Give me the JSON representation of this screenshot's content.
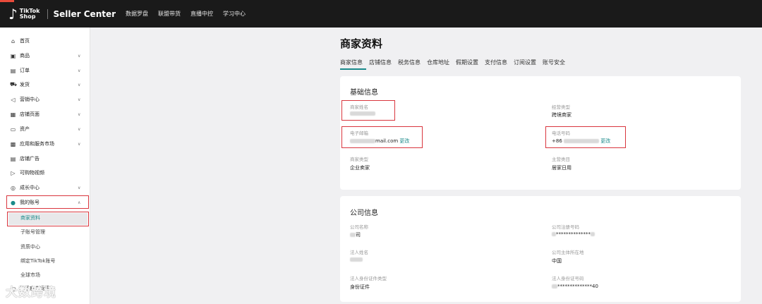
{
  "topbar": {
    "logo_line1": "TikTok",
    "logo_line2": "Shop",
    "seller_center": "Seller Center",
    "nav": [
      "数据罗盘",
      "联盟带货",
      "直播中控",
      "学习中心"
    ]
  },
  "sidebar": {
    "items": [
      {
        "label": "首页",
        "icon": "home-icon",
        "glyph": "⌂",
        "chevron": false
      },
      {
        "label": "商品",
        "icon": "product-icon",
        "glyph": "▣",
        "chevron": true
      },
      {
        "label": "订单",
        "icon": "order-icon",
        "glyph": "▤",
        "chevron": true
      },
      {
        "label": "发货",
        "icon": "truck-icon",
        "glyph": "⛟",
        "chevron": true
      },
      {
        "label": "营销中心",
        "icon": "megaphone-icon",
        "glyph": "◁",
        "chevron": true
      },
      {
        "label": "店铺页面",
        "icon": "store-icon",
        "glyph": "▦",
        "chevron": true
      },
      {
        "label": "资产",
        "icon": "wallet-icon",
        "glyph": "▭",
        "chevron": true
      },
      {
        "label": "应用和服务市场",
        "icon": "apps-icon",
        "glyph": "▩",
        "chevron": true
      },
      {
        "label": "店铺广告",
        "icon": "ad-icon",
        "glyph": "▤",
        "chevron": false
      },
      {
        "label": "可购物视频",
        "icon": "video-icon",
        "glyph": "▷",
        "chevron": false
      },
      {
        "label": "成长中心",
        "icon": "growth-icon",
        "glyph": "◎",
        "chevron": true
      },
      {
        "label": "我的账号",
        "icon": "user-icon",
        "glyph": "●",
        "chevron": true
      }
    ],
    "subitems": [
      "商家资料",
      "子账号管理",
      "资质中心",
      "绑定TikTok账号",
      "全球市场"
    ],
    "bottom_item": "联系官方运营",
    "expand_chevron": "∨",
    "collapse_chevron": "∧"
  },
  "watermark": "大数跨境",
  "main": {
    "title": "商家资料",
    "tabs": [
      "商家信息",
      "店铺信息",
      "税务信息",
      "仓库地址",
      "假期设置",
      "支付信息",
      "订阅设置",
      "账号安全"
    ],
    "basic": {
      "title": "基础信息",
      "merchant_name_label": "商家姓名",
      "business_type_label": "经营类型",
      "business_type_value": "跨境商家",
      "email_label": "电子邮箱",
      "email_suffix": "mail.com",
      "change": "更改",
      "phone_label": "电话号码",
      "phone_prefix": "+86",
      "merchant_type_label": "商家类型",
      "merchant_type_value": "企业卖家",
      "main_category_label": "主营类目",
      "main_category_value": "居家日用"
    },
    "company": {
      "title": "公司信息",
      "company_name_label": "公司名称",
      "company_name_value": "司",
      "reg_no_label": "公司注册号码",
      "reg_no_value": "**************",
      "legal_name_label": "法人姓名",
      "location_label": "公司主体所在地",
      "location_value": "中国",
      "id_type_label": "法人身份证件类型",
      "id_type_value": "身份证件",
      "id_no_label": "法人身份证号码",
      "id_no_value": "**************40"
    }
  }
}
